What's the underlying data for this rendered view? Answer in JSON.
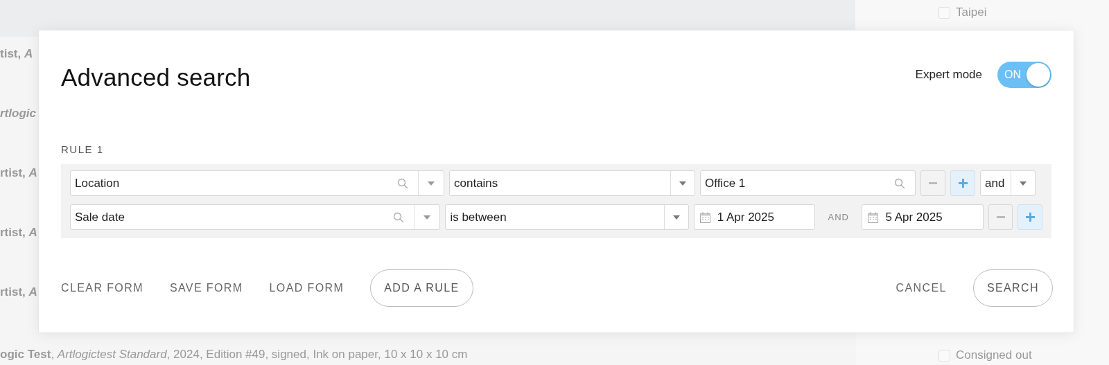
{
  "background": {
    "list_snippets": [
      {
        "text": "tist, *A*"
      },
      {
        "text": "*rtlogic*"
      },
      {
        "text": "rtist, *A*"
      },
      {
        "text": "rtist, *A*"
      },
      {
        "text": "rtist, *A*"
      }
    ],
    "bottom_line": "**ogic Test**, *Artlogictest Standard*, 2024, Edition #49, signed, Ink on paper, 10 x 10 x 10 cm",
    "sidebar_filters": [
      {
        "label": "Taipei",
        "checked": false
      },
      {
        "label": "Consigned out",
        "checked": false
      }
    ]
  },
  "dialog": {
    "title": "Advanced search",
    "expert_mode": {
      "label": "Expert mode",
      "on": true,
      "on_text": "ON"
    },
    "rule": {
      "label": "RULE 1",
      "rows": [
        {
          "field": "Location",
          "operator": "contains",
          "kind": "search",
          "value": "Office 1",
          "conjunction": "and"
        },
        {
          "field": "Sale date",
          "operator": "is between",
          "kind": "date_range",
          "from": "1 Apr 2025",
          "joiner": "AND",
          "to": "5 Apr 2025"
        }
      ]
    },
    "actions_left": [
      {
        "label": "CLEAR FORM",
        "kind": "text"
      },
      {
        "label": "SAVE FORM",
        "kind": "text"
      },
      {
        "label": "LOAD FORM",
        "kind": "text"
      },
      {
        "label": "ADD A RULE",
        "kind": "pill"
      }
    ],
    "actions_right": [
      {
        "label": "CANCEL",
        "kind": "text"
      },
      {
        "label": "SEARCH",
        "kind": "pill"
      }
    ]
  }
}
